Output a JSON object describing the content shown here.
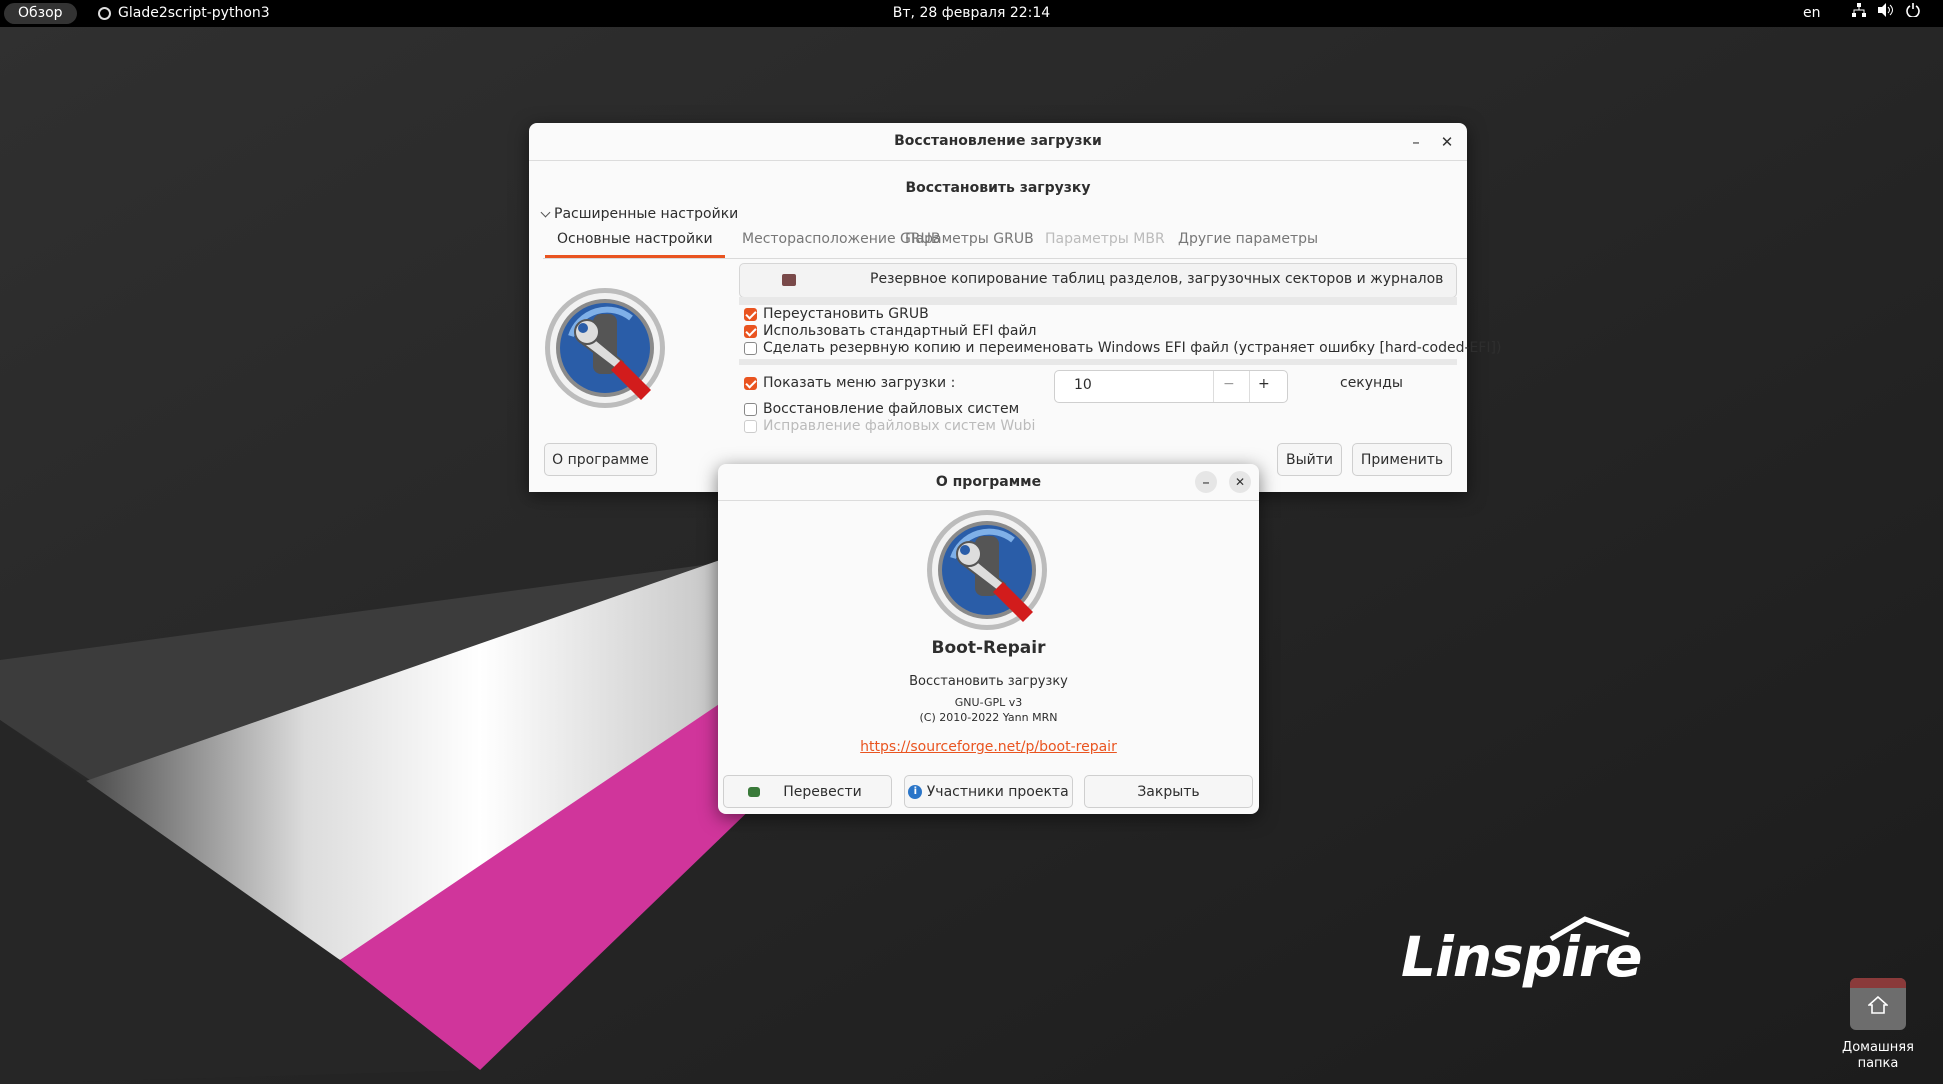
{
  "topbar": {
    "overview": "Обзор",
    "app": "Glade2script-python3",
    "clock": "Вт, 28 февраля  22:14",
    "lang": "en"
  },
  "main_window": {
    "title": "Восстановление загрузки",
    "heading": "Восстановить загрузку",
    "advanced_label": "Расширенные настройки",
    "tabs": [
      {
        "label": "Основные настройки",
        "state": "active"
      },
      {
        "label": "Месторасположение GRUB",
        "state": "normal"
      },
      {
        "label": "Параметры GRUB",
        "state": "normal"
      },
      {
        "label": "Параметры MBR",
        "state": "disabled"
      },
      {
        "label": "Другие параметры",
        "state": "normal"
      }
    ],
    "backup_button": "Резервное копирование таблиц разделов, загрузочных секторов и журналов",
    "options": [
      {
        "label": "Переустановить GRUB",
        "checked": true
      },
      {
        "label": "Использовать стандартный EFI файл",
        "checked": true
      },
      {
        "label": "Сделать резервную копию и переименовать Windows EFI файл (устраняет ошибку [hard-coded-EFI])",
        "checked": false
      }
    ],
    "boot_menu": {
      "label": "Показать меню загрузки :",
      "checked": true,
      "value": "10",
      "unit": "секунды"
    },
    "options2": [
      {
        "label": "Восстановление файловых систем",
        "checked": false
      },
      {
        "label": "Исправление файловых систем  Wubi",
        "checked": false,
        "disabled": true
      }
    ],
    "about_button": "О программе",
    "quit_button": "Выйти",
    "apply_button": "Применить"
  },
  "about_dialog": {
    "title": "О программе",
    "app_name": "Boot-Repair",
    "description": "Восстановить загрузку",
    "license": "GNU-GPL v3",
    "copyright": "(C) 2010-2022 Yann MRN",
    "link": "https://sourceforge.net/p/boot-repair",
    "translate_button": "Перевести",
    "credits_button": "Участники проекта",
    "close_button": "Закрыть"
  },
  "desktop": {
    "brand": "Linspire",
    "home_folder": "Домашняя папка"
  },
  "colors": {
    "accent": "#e95420",
    "magenta": "#d0359b"
  }
}
